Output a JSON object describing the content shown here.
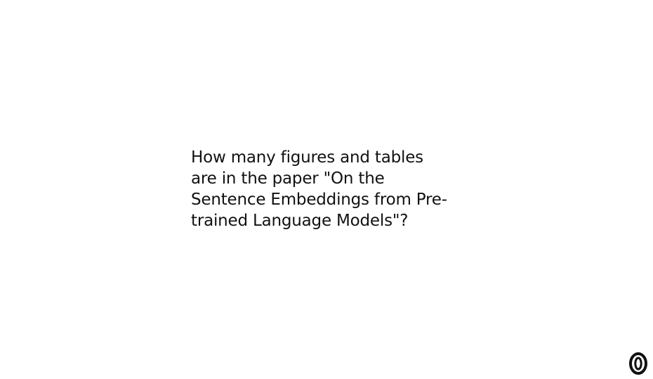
{
  "question": {
    "lines": [
      "How many figures and tables",
      "are in the paper \"On the",
      "Sentence Embeddings from Pre-",
      "trained Language Models\"?"
    ]
  },
  "logo": {
    "icon": "stylized-zero-logo-icon",
    "color": "#111111"
  }
}
